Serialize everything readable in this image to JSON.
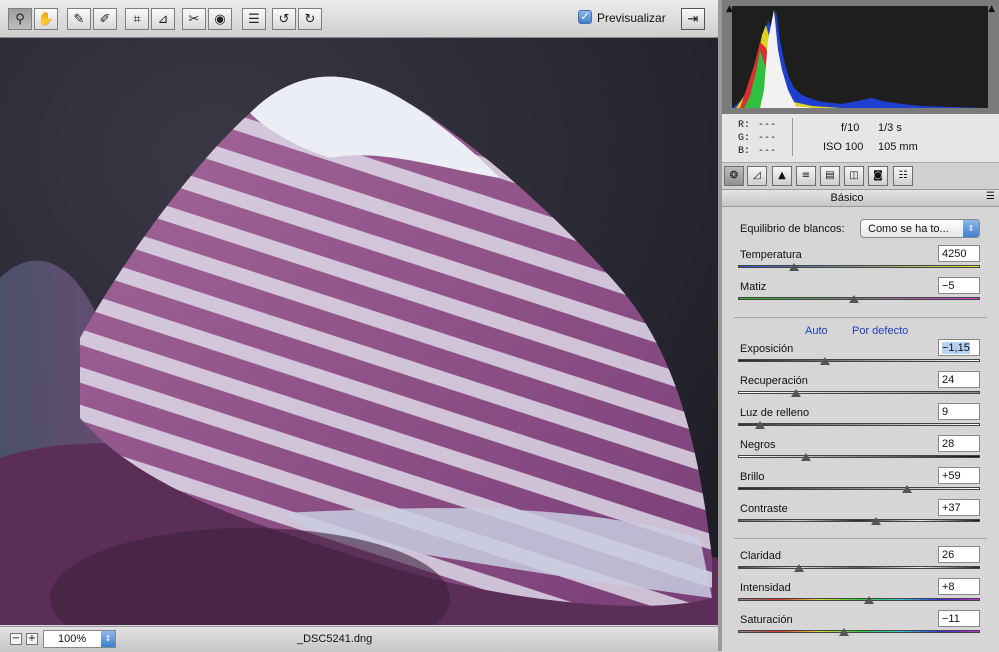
{
  "toolbar": {
    "tools": [
      {
        "icon": "zoom-icon",
        "glyph": "⚲"
      },
      {
        "icon": "hand-icon",
        "glyph": "✋"
      },
      {
        "icon": "white-balance-eyedropper-icon",
        "glyph": "✎"
      },
      {
        "icon": "color-sampler-icon",
        "glyph": "✐"
      },
      {
        "icon": "crop-icon",
        "glyph": "⌗"
      },
      {
        "icon": "straighten-icon",
        "glyph": "⊿"
      },
      {
        "icon": "retouch-icon",
        "glyph": "✂"
      },
      {
        "icon": "red-eye-icon",
        "glyph": "◉"
      },
      {
        "icon": "preferences-icon",
        "glyph": "☰"
      },
      {
        "icon": "rotate-left-icon",
        "glyph": "↺"
      },
      {
        "icon": "rotate-right-icon",
        "glyph": "↻"
      }
    ],
    "preview_label": "Previsualizar",
    "preview_checked": true
  },
  "status": {
    "zoom": "100%",
    "filename": "_DSC5241.dng"
  },
  "histogram": {
    "up_left": "▲",
    "up_right": "▲"
  },
  "info": {
    "r_label": "R:",
    "r_value": "---",
    "g_label": "G:",
    "g_value": "---",
    "b_label": "B:",
    "b_value": "---",
    "aperture": "f/10",
    "shutter": "1/3 s",
    "iso": "ISO 100",
    "focal": "105 mm"
  },
  "panel": {
    "title": "Básico",
    "menu": "☰",
    "wb_label": "Equilibrio de blancos:",
    "wb_value": "Como se ha to...",
    "auto": "Auto",
    "default": "Por defecto"
  },
  "sliders": {
    "temperatura": {
      "label": "Temperatura",
      "value": "4250",
      "pos": 0.23
    },
    "matiz": {
      "label": "Matiz",
      "value": "−5",
      "pos": 0.48
    },
    "exposicion": {
      "label": "Exposición",
      "value": "−1,15",
      "pos": 0.36
    },
    "recuperacion": {
      "label": "Recuperación",
      "value": "24",
      "pos": 0.24
    },
    "luz": {
      "label": "Luz de relleno",
      "value": "9",
      "pos": 0.09
    },
    "negros": {
      "label": "Negros",
      "value": "28",
      "pos": 0.28
    },
    "brillo": {
      "label": "Brillo",
      "value": "+59",
      "pos": 0.7
    },
    "contraste": {
      "label": "Contraste",
      "value": "+37",
      "pos": 0.57
    },
    "claridad": {
      "label": "Claridad",
      "value": "26",
      "pos": 0.25
    },
    "intensidad": {
      "label": "Intensidad",
      "value": "+8",
      "pos": 0.54
    },
    "saturacion": {
      "label": "Saturación",
      "value": "−11",
      "pos": 0.44
    }
  },
  "colors": {
    "link": "#1d3fbe",
    "accent": "#3d7fd1"
  }
}
